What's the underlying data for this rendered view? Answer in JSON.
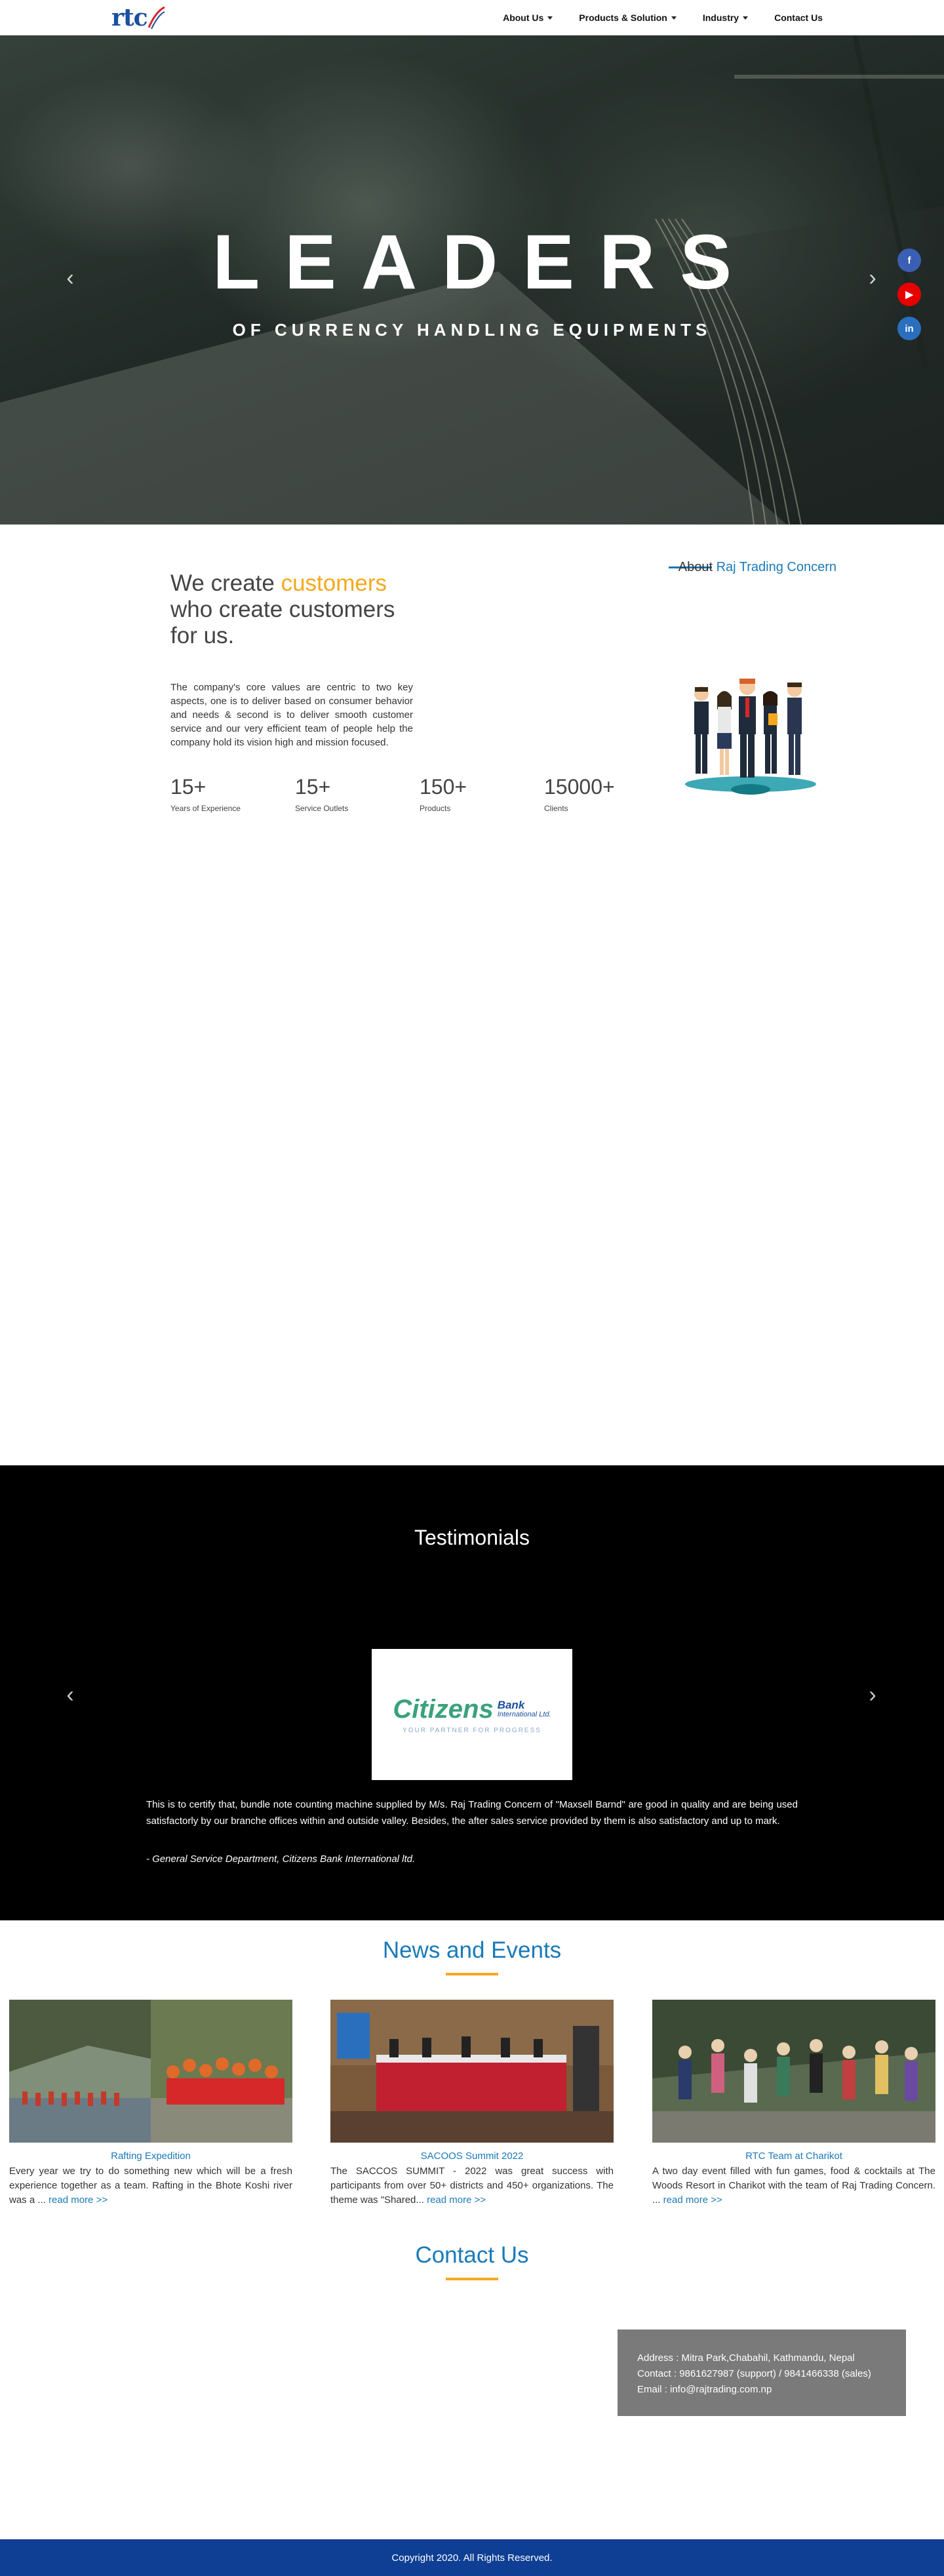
{
  "navbar": {
    "logo_text": "rtc",
    "items": [
      {
        "label": "About Us",
        "dropdown": true
      },
      {
        "label": "Products & Solution",
        "dropdown": true
      },
      {
        "label": "Industry",
        "dropdown": true
      },
      {
        "label": "Contact Us",
        "dropdown": false
      }
    ]
  },
  "hero": {
    "title": "LEADERS",
    "subtitle": "OF CURRENCY HANDLING EQUIPMENTS",
    "prev_icon": "chevron-left-icon",
    "next_icon": "chevron-right-icon"
  },
  "social": [
    {
      "name": "facebook-icon",
      "glyph": "f",
      "color": "#3b5fb5"
    },
    {
      "name": "youtube-icon",
      "glyph": "▶",
      "color": "#e60000"
    },
    {
      "name": "linkedin-icon",
      "glyph": "in",
      "color": "#2a6fbd"
    }
  ],
  "about": {
    "heading_pre": "We create ",
    "heading_accent": "customers",
    "heading_post": " who create customers for us.",
    "body": "The company's core values are centric to two key aspects, one is to deliver based on consumer behavior and needs & second is to deliver smooth customer service and our very efficient team of people help the company hold its vision high and mission focused.",
    "link_pre": "About ",
    "link_highlight": "Raj Trading Concern",
    "accent_color": "#f5a81c",
    "link_color": "#1a7ab8"
  },
  "stats": [
    {
      "value": "15+",
      "label": "Years of Experience"
    },
    {
      "value": "15+",
      "label": "Service Outlets"
    },
    {
      "value": "150+",
      "label": "Products"
    },
    {
      "value": "15000+",
      "label": "Clients"
    }
  ],
  "testimonials": {
    "title": "Testimonials",
    "logo_main": "Citizens",
    "logo_bank": "Bank",
    "logo_intl": "International Ltd.",
    "logo_tagline": "YOUR PARTNER FOR PROGRESS",
    "quote": "This is to certify that, bundle note counting machine supplied by M/s. Raj Trading Concern of \"Maxsell Barnd\" are good in quality and are being used satisfactorly by our branche offices within and outside valley. Besides, the after sales service provided by them is also satisfactory and up to mark.",
    "author": "- General Service Department, Citizens Bank International ltd."
  },
  "news": {
    "title": "News and Events",
    "items": [
      {
        "caption": "Rafting Expedition",
        "text": "Every year we try to do something new which will be a fresh experience together as a team. Rafting in the Bhote Koshi river was a ... ",
        "more": "read more >>"
      },
      {
        "caption": "SACOOS Summit 2022",
        "text": "The SACCOS SUMMIT - 2022 was great success with participants from over 50+ districts and 450+ organizations. The theme was \"Shared... ",
        "more": "read more >>"
      },
      {
        "caption": "RTC Team at Charikot",
        "text": "A two day event filled with fun games, food & cocktails at The Woods Resort in Charikot with the team of Raj Trading Concern. ... ",
        "more": "read more >>"
      }
    ]
  },
  "contact": {
    "title": "Contact Us",
    "address": "Address : Mitra Park,Chabahil, Kathmandu, Nepal",
    "phone": "Contact : 9861627987 (support) / 9841466338 (sales)",
    "email": "Email : info@rajtrading.com.np"
  },
  "footer": {
    "text": "Copyright 2020. All Rights Reserved.",
    "color": "#0f3f94"
  }
}
